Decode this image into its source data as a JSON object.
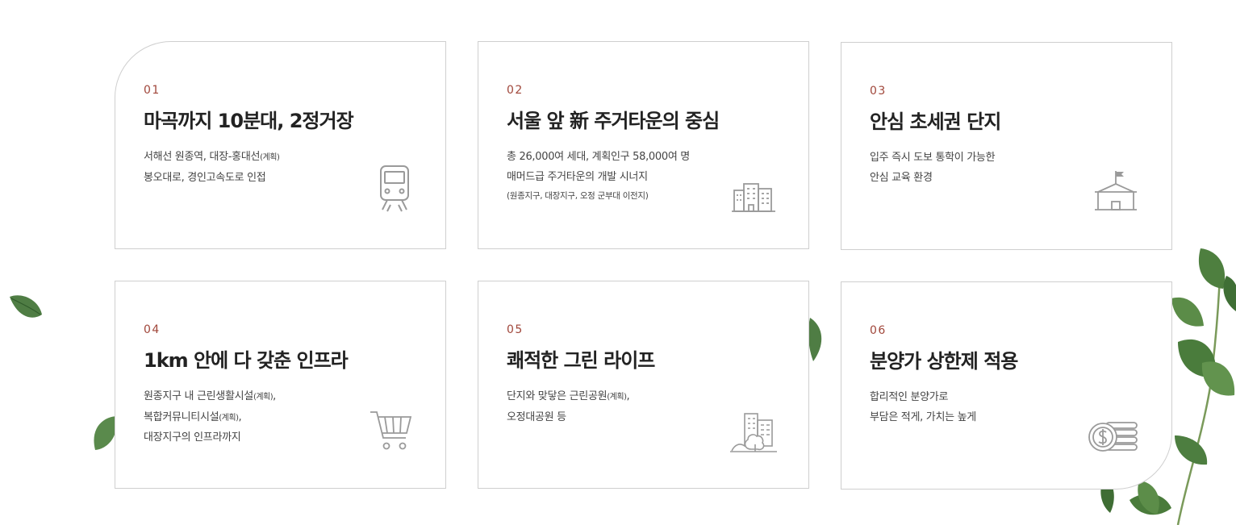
{
  "cards": [
    {
      "num": "01",
      "title": "마곡까지 10분대, 2정거장",
      "desc1": "서해선 원종역, 대장-홍대선",
      "desc1_small": "(계획)",
      "desc2": "봉오대로, 경인고속도로 인접",
      "icon": "train-icon"
    },
    {
      "num": "02",
      "title": "서울 앞 新 주거타운의 중심",
      "desc1": "총 26,000여 세대, 계획인구 58,000여 명",
      "desc2": "매머드급 주거타운의 개발 시너지",
      "note": "(원종지구, 대장지구, 오정 군부대 이전지)",
      "icon": "buildings-icon"
    },
    {
      "num": "03",
      "title": "안심 초세권 단지",
      "desc1": "입주 즉시 도보 통학이 가능한",
      "desc2": "안심 교육 환경",
      "icon": "school-icon"
    },
    {
      "num": "04",
      "title": "1km 안에 다 갖춘 인프라",
      "desc1": "원종지구 내 근린생활시설",
      "desc1_small": "(계획)",
      "desc1_tail": ",",
      "desc2": "복합커뮤니티시설",
      "desc2_small": "(계획)",
      "desc2_tail": ",",
      "desc3": "대장지구의 인프라까지",
      "icon": "cart-icon"
    },
    {
      "num": "05",
      "title": "쾌적한 그린 라이프",
      "desc1": "단지와 맞닿은 근린공원",
      "desc1_small": "(계획)",
      "desc1_tail": ",",
      "desc2": "오정대공원 등",
      "icon": "park-icon"
    },
    {
      "num": "06",
      "title": "분양가 상한제 적용",
      "desc1": "합리적인 분양가로",
      "desc2": "부담은 적게, 가치는 높게",
      "icon": "coins-icon"
    }
  ],
  "colors": {
    "number_accent": "#a0463a",
    "title": "#222222",
    "text": "#444444",
    "border": "#cfcfcf",
    "icon_gray": "#9a9a9a",
    "leaf": "#5b8a4a"
  }
}
